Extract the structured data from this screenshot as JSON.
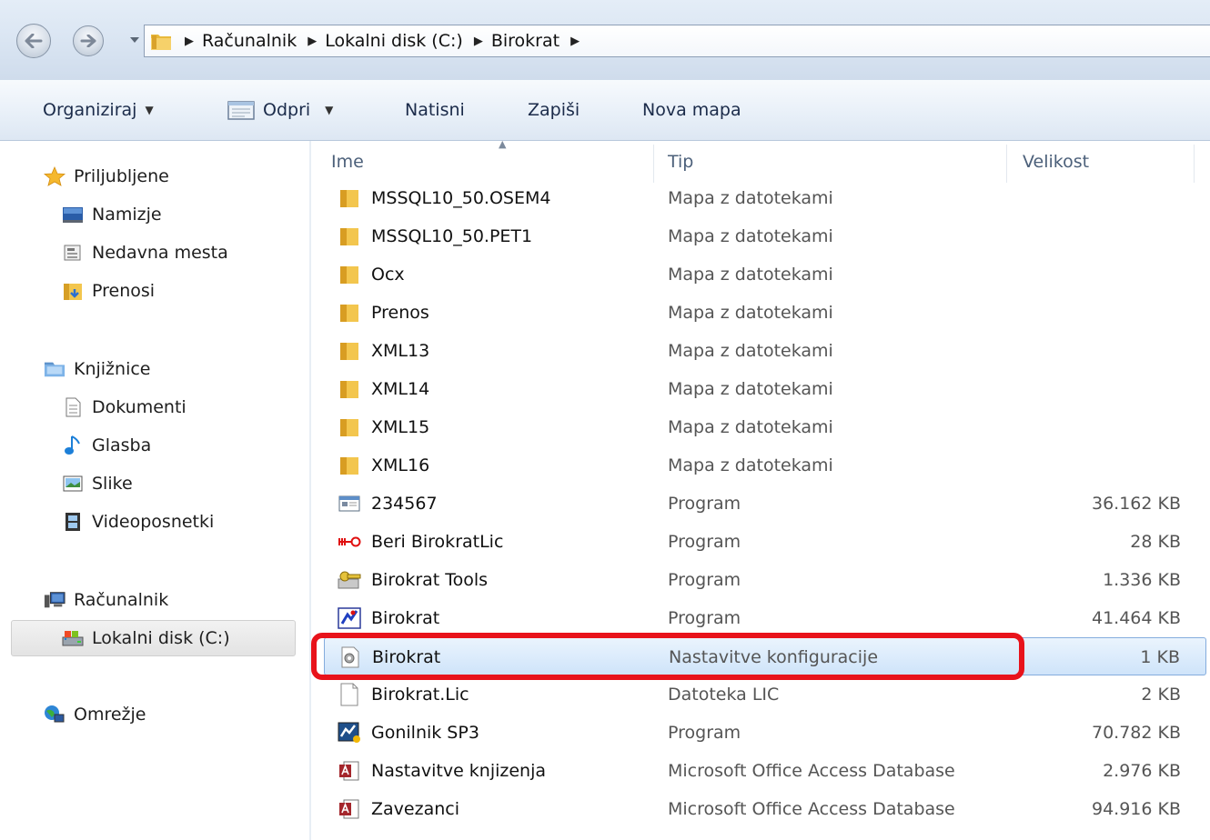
{
  "address": {
    "crumbs": [
      "Računalnik",
      "Lokalni disk (C:)",
      "Birokrat"
    ]
  },
  "commands": {
    "organize": "Organiziraj",
    "open": "Odpri",
    "print": "Natisni",
    "burn": "Zapiši",
    "new_folder": "Nova mapa"
  },
  "nav": {
    "favorites": "Priljubljene",
    "desktop": "Namizje",
    "recent": "Nedavna mesta",
    "downloads": "Prenosi",
    "libraries": "Knjižnice",
    "documents": "Dokumenti",
    "music": "Glasba",
    "pictures": "Slike",
    "videos": "Videoposnetki",
    "computer": "Računalnik",
    "local_disk": "Lokalni disk (C:)",
    "network": "Omrežje"
  },
  "columns": {
    "name": "Ime",
    "type": "Tip",
    "size": "Velikost"
  },
  "files": [
    {
      "name": "MSSQL10_50.OSEM4",
      "type": "Mapa z datotekami",
      "size": "",
      "icon": "folder-icon"
    },
    {
      "name": "MSSQL10_50.PET1",
      "type": "Mapa z datotekami",
      "size": "",
      "icon": "folder-icon"
    },
    {
      "name": "Ocx",
      "type": "Mapa z datotekami",
      "size": "",
      "icon": "folder-icon"
    },
    {
      "name": "Prenos",
      "type": "Mapa z datotekami",
      "size": "",
      "icon": "folder-icon"
    },
    {
      "name": "XML13",
      "type": "Mapa z datotekami",
      "size": "",
      "icon": "folder-icon"
    },
    {
      "name": "XML14",
      "type": "Mapa z datotekami",
      "size": "",
      "icon": "folder-icon"
    },
    {
      "name": "XML15",
      "type": "Mapa z datotekami",
      "size": "",
      "icon": "folder-icon"
    },
    {
      "name": "XML16",
      "type": "Mapa z datotekami",
      "size": "",
      "icon": "folder-icon"
    },
    {
      "name": "234567",
      "type": "Program",
      "size": "36.162 KB",
      "icon": "program-window-icon"
    },
    {
      "name": "Beri BirokratLic",
      "type": "Program",
      "size": "28 KB",
      "icon": "key-reader-icon"
    },
    {
      "name": "Birokrat Tools",
      "type": "Program",
      "size": "1.336 KB",
      "icon": "tools-key-icon"
    },
    {
      "name": "Birokrat",
      "type": "Program",
      "size": "41.464 KB",
      "icon": "birokrat-app-icon"
    },
    {
      "name": "Birokrat",
      "type": "Nastavitve konfiguracije",
      "size": "1 KB",
      "icon": "config-file-icon",
      "selected": true
    },
    {
      "name": "Birokrat.Lic",
      "type": "Datoteka LIC",
      "size": "2 KB",
      "icon": "blank-file-icon"
    },
    {
      "name": "Gonilnik SP3",
      "type": "Program",
      "size": "70.782 KB",
      "icon": "driver-app-icon"
    },
    {
      "name": "Nastavitve knjizenja",
      "type": "Microsoft Office Access Database",
      "size": "2.976 KB",
      "icon": "access-db-icon"
    },
    {
      "name": "Zavezanci",
      "type": "Microsoft Office Access Database",
      "size": "94.916 KB",
      "icon": "access-db-icon"
    }
  ]
}
